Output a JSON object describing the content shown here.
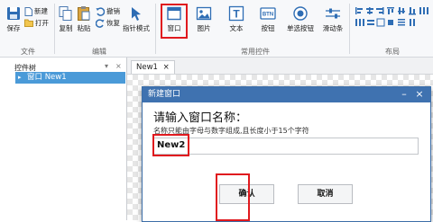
{
  "ribbon": {
    "groups": {
      "file": "文件",
      "edit": "编辑",
      "common_controls": "常用控件",
      "layout": "布局"
    },
    "buttons": {
      "save": "保存",
      "new": "新建",
      "open": "打开",
      "copy": "复制",
      "paste": "粘贴",
      "undo": "撤销",
      "redo": "恢复",
      "pointer_mode": "指针模式",
      "window": "窗口",
      "image": "图片",
      "text": "文本",
      "button": "按钮",
      "radio_button": "单选按钮",
      "slider": "滑动条"
    },
    "icons": {
      "btn_glyph": "BTN",
      "text_glyph": "T"
    }
  },
  "tree": {
    "title": "控件树",
    "item": "窗口 New1",
    "side_tab": "控件树"
  },
  "document": {
    "tab_label": "New1"
  },
  "dialog": {
    "title": "新建窗口",
    "heading": "请输入窗口名称：",
    "hint": "名称只能由字母与数字组成,且长度小于15个字符",
    "input_value": "New2",
    "confirm_label": "确认",
    "cancel_label": "取消"
  },
  "colors": {
    "highlight": "#e0191e",
    "titlebar": "#3f72b0",
    "selection": "#4a9ad8"
  }
}
